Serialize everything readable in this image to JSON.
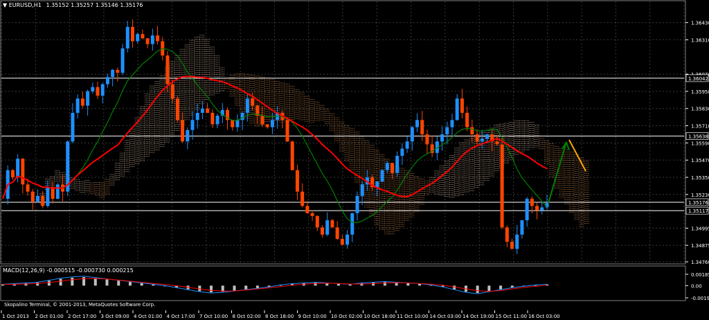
{
  "header": {
    "symbol": "EURUSD,H1",
    "ohlc": "1.35152 1.35257 1.35146 1.35176",
    "macd_label": "MACD(12,26,9) -0.000515 -0.000730 0.000215",
    "copyright": "Skopalino Terminal, © 2001-2013, MetaQuotes Software Corp."
  },
  "colors": {
    "background": "#000000",
    "bull_candle": "#1e90ff",
    "bear_candle": "#ff4500",
    "ma_slow": "#ff0000",
    "ma_fast": "#008000",
    "cloud_bull": "#ffdab9",
    "cloud_bear": "#f4a460",
    "arrow_up": "#008000",
    "arrow_down": "#ffa500",
    "macd_line": "#1e90ff",
    "signal_line": "#ff0000",
    "histogram": "#c0c0c0",
    "hline": "#ffffff"
  },
  "chart_data": {
    "type": "candlestick",
    "symbol": "EURUSD",
    "timeframe": "H1",
    "price_axis_labels": [
      "1.36430",
      "1.36310",
      "1.36070",
      "1.35950",
      "1.35830",
      "1.35710",
      "1.35590",
      "1.35470",
      "1.35350",
      "1.35230",
      "1.34995",
      "1.34875",
      "1.34760"
    ],
    "price_tick_values": [
      1.3643,
      1.3631,
      1.3607,
      1.3595,
      1.3583,
      1.3571,
      1.3559,
      1.3547,
      1.3535,
      1.3523,
      1.34995,
      1.34875,
      1.3476
    ],
    "ylim": [
      1.3476,
      1.3652
    ],
    "highlighted_levels": [
      {
        "label": "1.36042",
        "value": 1.36042
      },
      {
        "label": "1.35638",
        "value": 1.35638
      },
      {
        "label": "1.35176",
        "value": 1.35176
      },
      {
        "label": "1.35117",
        "value": 1.35117
      }
    ],
    "time_labels": [
      "1 Oct 2013",
      "2 Oct 01:00",
      "2 Oct 17:00",
      "3 Oct 09:00",
      "4 Oct 01:00",
      "4 Oct 17:00",
      "7 Oct 10:00",
      "8 Oct 02:00",
      "8 Oct 18:00",
      "9 Oct 10:00",
      "10 Oct 02:00",
      "10 Oct 18:00",
      "11 Oct 10:00",
      "14 Oct 03:00",
      "14 Oct 19:00",
      "15 Oct 11:00",
      "16 Oct 03:00"
    ],
    "price_path": [
      1.352,
      1.354,
      1.3535,
      1.3548,
      1.353,
      1.3525,
      1.3518,
      1.3522,
      1.3515,
      1.3528,
      1.352,
      1.353,
      1.3525,
      1.356,
      1.358,
      1.359,
      1.3585,
      1.3595,
      1.3598,
      1.3592,
      1.36,
      1.3605,
      1.361,
      1.3608,
      1.3625,
      1.364,
      1.363,
      1.3635,
      1.3632,
      1.3628,
      1.3634,
      1.363,
      1.362,
      1.36,
      1.359,
      1.3575,
      1.356,
      1.3568,
      1.3575,
      1.358,
      1.3583,
      1.358,
      1.3572,
      1.3578,
      1.3582,
      1.3575,
      1.357,
      1.3575,
      1.358,
      1.359,
      1.3585,
      1.3578,
      1.3572,
      1.357,
      1.3575,
      1.358,
      1.3575,
      1.356,
      1.354,
      1.3525,
      1.3515,
      1.351,
      1.3508,
      1.35,
      1.3495,
      1.3505,
      1.35,
      1.3492,
      1.3488,
      1.3495,
      1.351,
      1.3522,
      1.353,
      1.3535,
      1.3528,
      1.3532,
      1.354,
      1.3545,
      1.3538,
      1.355,
      1.3555,
      1.356,
      1.357,
      1.3575,
      1.3565,
      1.3558,
      1.3552,
      1.356,
      1.3565,
      1.357,
      1.3575,
      1.359,
      1.358,
      1.357,
      1.3565,
      1.356,
      1.3562,
      1.3565,
      1.356,
      1.3558,
      1.35,
      1.349,
      1.3485,
      1.3495,
      1.3505,
      1.352,
      1.3515,
      1.3512,
      1.3514,
      1.3517
    ],
    "indicators": [
      "Moving Average (red)",
      "Moving Average (green)",
      "Ichimoku Kinko Hyo cloud",
      "MACD(12,26,9)"
    ],
    "macd": {
      "label": "MACD(12,26,9)",
      "values": [
        -0.000515,
        -0.00073,
        0.000215
      ],
      "axis_labels": [
        "0.001853",
        "0.00",
        "-0.001995"
      ],
      "axis_values": [
        0.001853,
        0,
        -0.001995
      ],
      "histogram": [
        0.0002,
        0.0003,
        0.0004,
        0.0005,
        0.0008,
        0.0011,
        0.0013,
        0.0014,
        0.0012,
        0.001,
        0.0008,
        0.0006,
        0.0004,
        0.0002,
        0.0,
        -0.0003,
        -0.0006,
        -0.0009,
        -0.0011,
        -0.001,
        -0.0008,
        -0.0006,
        -0.0004,
        -0.0002,
        0.0001,
        0.0003,
        0.0004,
        0.0005,
        0.0004,
        0.0003,
        0.0002,
        0.0004,
        0.0005,
        0.0006,
        0.0005,
        0.0004,
        0.0003,
        0.0001,
        -0.0002,
        -0.0006,
        -0.001,
        -0.0012,
        -0.0009,
        -0.0006,
        -0.0003,
        -0.0001,
        0.0001,
        0.0002
      ]
    }
  }
}
